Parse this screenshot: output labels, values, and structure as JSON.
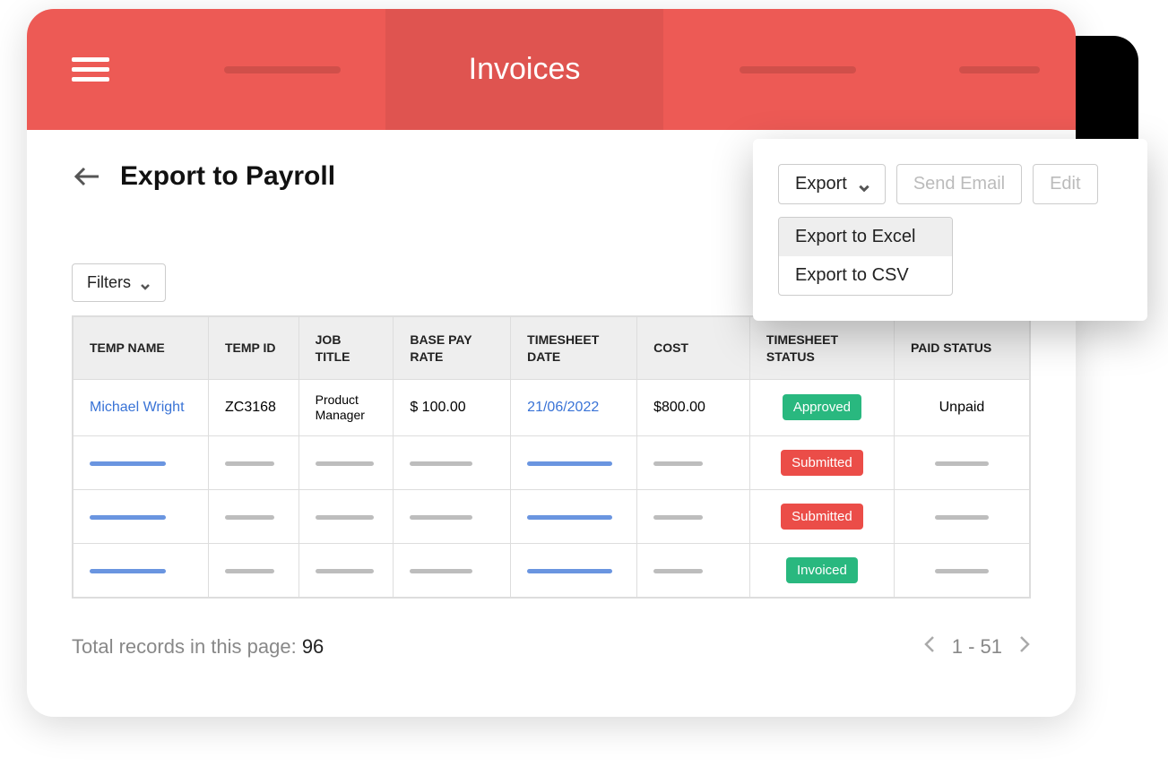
{
  "nav": {
    "active_label": "Invoices"
  },
  "page": {
    "title": "Export to Payroll"
  },
  "actions": {
    "export_label": "Export",
    "send_email_label": "Send Email",
    "edit_label": "Edit",
    "dropdown": {
      "export_excel": "Export to Excel",
      "export_csv": "Export to CSV"
    }
  },
  "filters": {
    "label": "Filters"
  },
  "table": {
    "columns": {
      "temp_name": "TEMP NAME",
      "temp_id": "TEMP ID",
      "job_title": "JOB TITLE",
      "base_pay_rate": "BASE PAY RATE",
      "timesheet_date": "TIMESHEET DATE",
      "cost": "COST",
      "timesheet_status": "TIMESHEET STATUS",
      "paid_status": "PAID STATUS"
    },
    "rows": [
      {
        "temp_name": "Michael Wright",
        "temp_id": "ZC3168",
        "job_title": "Product Manager",
        "base_pay_rate": "$ 100.00",
        "timesheet_date": "21/06/2022",
        "cost": "$800.00",
        "timesheet_status": "Approved",
        "timesheet_status_class": "status-approved",
        "paid_status": "Unpaid"
      },
      {
        "timesheet_status": "Submitted",
        "timesheet_status_class": "status-submitted"
      },
      {
        "timesheet_status": "Submitted",
        "timesheet_status_class": "status-submitted"
      },
      {
        "timesheet_status": "Invoiced",
        "timesheet_status_class": "status-invoiced"
      }
    ]
  },
  "footer": {
    "total_label": "Total records in this page: ",
    "total_count": "96",
    "page_range": "1 - 51"
  }
}
